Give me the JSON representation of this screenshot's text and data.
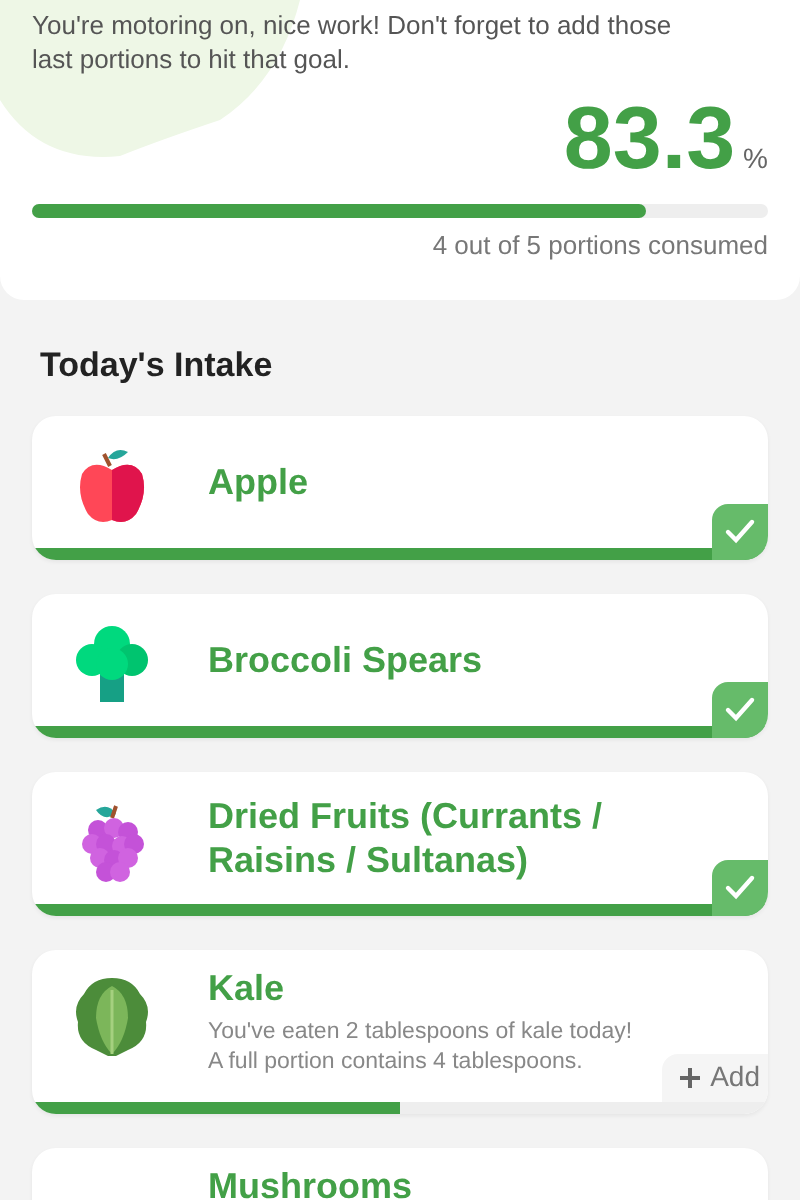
{
  "summary": {
    "message": "You're motoring on, nice work! Don't forget to add those last portions to hit that goal.",
    "percent": "83.3",
    "unit": "%",
    "level": 0.833,
    "caption": "4 out of 5 portions consumed"
  },
  "section_title": "Today's Intake",
  "items": [
    {
      "name": "Apple",
      "checked": true,
      "level": 1
    },
    {
      "name": "Broccoli Spears",
      "checked": true,
      "level": 1
    },
    {
      "name": "Dried Fruits (Currants / Raisins / Sultanas)",
      "checked": true,
      "level": 1
    },
    {
      "name": "Kale",
      "note": "You've eaten 2 tablespoons of kale today! A full portion contains 4 tablespoons.",
      "checked": false,
      "level": 0.5,
      "action": "Add"
    },
    {
      "name": "Mushrooms"
    }
  ]
}
